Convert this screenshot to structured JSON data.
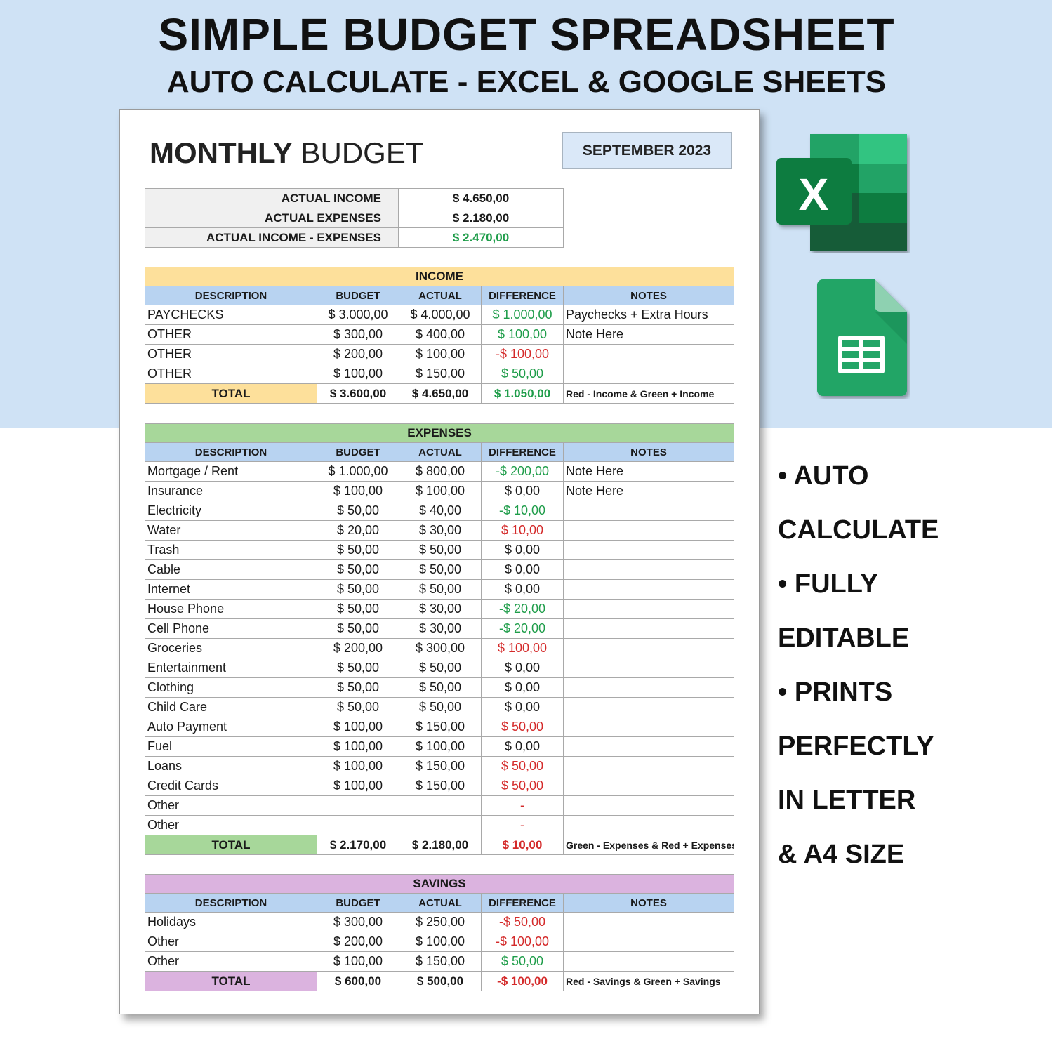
{
  "banner": {
    "title": "SIMPLE BUDGET SPREADSHEET",
    "subtitle": "AUTO CALCULATE - EXCEL & GOOGLE SHEETS"
  },
  "sheet": {
    "title_bold": "MONTHLY",
    "title_light": "BUDGET",
    "month": "SEPTEMBER 2023"
  },
  "summary": [
    {
      "label": "ACTUAL INCOME",
      "value": "$ 4.650,00"
    },
    {
      "label": "ACTUAL EXPENSES",
      "value": "$ 2.180,00"
    },
    {
      "label": "ACTUAL INCOME - EXPENSES",
      "value": "$ 2.470,00",
      "status": "pos"
    }
  ],
  "columns": {
    "description": "DESCRIPTION",
    "budget": "BUDGET",
    "actual": "ACTUAL",
    "difference": "DIFFERENCE",
    "notes": "NOTES"
  },
  "income": {
    "heading": "INCOME",
    "rows": [
      {
        "description": "PAYCHECKS",
        "budget": "$ 3.000,00",
        "actual": "$ 4.000,00",
        "difference": "$ 1.000,00",
        "status": "pos",
        "notes": "Paychecks + Extra Hours"
      },
      {
        "description": "OTHER",
        "budget": "$ 300,00",
        "actual": "$ 400,00",
        "difference": "$ 100,00",
        "status": "pos",
        "notes": "Note Here"
      },
      {
        "description": "OTHER",
        "budget": "$ 200,00",
        "actual": "$ 100,00",
        "difference": "-$ 100,00",
        "status": "neg",
        "notes": ""
      },
      {
        "description": "OTHER",
        "budget": "$ 100,00",
        "actual": "$ 150,00",
        "difference": "$ 50,00",
        "status": "pos",
        "notes": ""
      }
    ],
    "total": {
      "label": "TOTAL",
      "budget": "$ 3.600,00",
      "actual": "$ 4.650,00",
      "difference": "$ 1.050,00",
      "status": "pos",
      "notes": "Red - Income & Green + Income"
    }
  },
  "expenses": {
    "heading": "EXPENSES",
    "rows": [
      {
        "description": "Mortgage / Rent",
        "budget": "$ 1.000,00",
        "actual": "$ 800,00",
        "difference": "-$ 200,00",
        "status": "pos",
        "notes": "Note Here"
      },
      {
        "description": "Insurance",
        "budget": "$ 100,00",
        "actual": "$ 100,00",
        "difference": "$ 0,00",
        "status": "zero",
        "notes": "Note Here"
      },
      {
        "description": "Electricity",
        "budget": "$ 50,00",
        "actual": "$ 40,00",
        "difference": "-$ 10,00",
        "status": "pos",
        "notes": ""
      },
      {
        "description": "Water",
        "budget": "$ 20,00",
        "actual": "$ 30,00",
        "difference": "$ 10,00",
        "status": "neg",
        "notes": ""
      },
      {
        "description": "Trash",
        "budget": "$ 50,00",
        "actual": "$ 50,00",
        "difference": "$ 0,00",
        "status": "zero",
        "notes": ""
      },
      {
        "description": "Cable",
        "budget": "$ 50,00",
        "actual": "$ 50,00",
        "difference": "$ 0,00",
        "status": "zero",
        "notes": ""
      },
      {
        "description": "Internet",
        "budget": "$ 50,00",
        "actual": "$ 50,00",
        "difference": "$ 0,00",
        "status": "zero",
        "notes": ""
      },
      {
        "description": "House Phone",
        "budget": "$ 50,00",
        "actual": "$ 30,00",
        "difference": "-$ 20,00",
        "status": "pos",
        "notes": ""
      },
      {
        "description": "Cell Phone",
        "budget": "$ 50,00",
        "actual": "$ 30,00",
        "difference": "-$ 20,00",
        "status": "pos",
        "notes": ""
      },
      {
        "description": "Groceries",
        "budget": "$ 200,00",
        "actual": "$ 300,00",
        "difference": "$ 100,00",
        "status": "neg",
        "notes": ""
      },
      {
        "description": "Entertainment",
        "budget": "$ 50,00",
        "actual": "$ 50,00",
        "difference": "$ 0,00",
        "status": "zero",
        "notes": ""
      },
      {
        "description": "Clothing",
        "budget": "$ 50,00",
        "actual": "$ 50,00",
        "difference": "$ 0,00",
        "status": "zero",
        "notes": ""
      },
      {
        "description": "Child Care",
        "budget": "$ 50,00",
        "actual": "$ 50,00",
        "difference": "$ 0,00",
        "status": "zero",
        "notes": ""
      },
      {
        "description": "Auto Payment",
        "budget": "$ 100,00",
        "actual": "$ 150,00",
        "difference": "$ 50,00",
        "status": "neg",
        "notes": ""
      },
      {
        "description": "Fuel",
        "budget": "$ 100,00",
        "actual": "$ 100,00",
        "difference": "$ 0,00",
        "status": "zero",
        "notes": ""
      },
      {
        "description": "Loans",
        "budget": "$ 100,00",
        "actual": "$ 150,00",
        "difference": "$ 50,00",
        "status": "neg",
        "notes": ""
      },
      {
        "description": "Credit Cards",
        "budget": "$ 100,00",
        "actual": "$ 150,00",
        "difference": "$ 50,00",
        "status": "neg",
        "notes": ""
      },
      {
        "description": "Other",
        "budget": "",
        "actual": "",
        "difference": "-",
        "status": "neg",
        "notes": ""
      },
      {
        "description": "Other",
        "budget": "",
        "actual": "",
        "difference": "-",
        "status": "neg",
        "notes": ""
      }
    ],
    "total": {
      "label": "TOTAL",
      "budget": "$ 2.170,00",
      "actual": "$ 2.180,00",
      "difference": "$ 10,00",
      "status": "neg",
      "notes": "Green - Expenses & Red + Expenses"
    }
  },
  "savings": {
    "heading": "SAVINGS",
    "rows": [
      {
        "description": "Holidays",
        "budget": "$ 300,00",
        "actual": "$ 250,00",
        "difference": "-$ 50,00",
        "status": "neg",
        "notes": ""
      },
      {
        "description": "Other",
        "budget": "$ 200,00",
        "actual": "$ 100,00",
        "difference": "-$ 100,00",
        "status": "neg",
        "notes": ""
      },
      {
        "description": "Other",
        "budget": "$ 100,00",
        "actual": "$ 150,00",
        "difference": "$ 50,00",
        "status": "pos",
        "notes": ""
      }
    ],
    "total": {
      "label": "TOTAL",
      "budget": "$ 600,00",
      "actual": "$ 500,00",
      "difference": "-$ 100,00",
      "status": "neg",
      "notes": "Red - Savings & Green + Savings"
    }
  },
  "features": [
    "• AUTO",
    "CALCULATE",
    "• FULLY",
    "EDITABLE",
    "• PRINTS",
    "PERFECTLY",
    "IN LETTER",
    "& A4 SIZE"
  ],
  "icons": {
    "excel": "microsoft-excel-logo",
    "sheets": "google-sheets-logo",
    "excel_letter": "X"
  },
  "colors": {
    "banner_bg": "#cfe2f5",
    "income_header": "#fde09b",
    "expenses_header": "#a7d79a",
    "savings_header": "#dbb3df",
    "column_header": "#b8d3f1",
    "positive": "#1f9d4a",
    "negative": "#d42a2a"
  }
}
